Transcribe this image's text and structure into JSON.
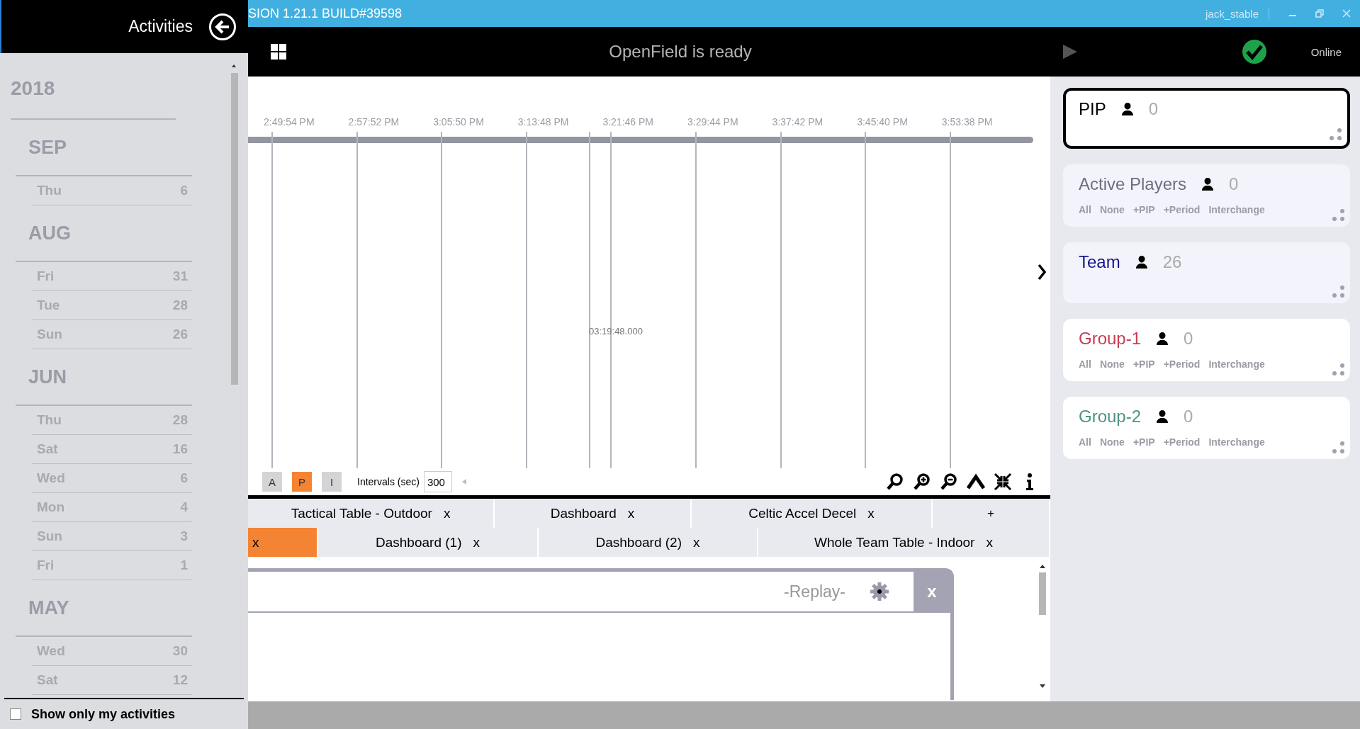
{
  "sidebar": {
    "title": "Activities",
    "years": [
      {
        "year": "2018",
        "months": [
          {
            "month": "SEP",
            "days": [
              {
                "weekday": "Thu",
                "day": "6"
              }
            ]
          },
          {
            "month": "AUG",
            "days": [
              {
                "weekday": "Fri",
                "day": "31"
              },
              {
                "weekday": "Tue",
                "day": "28"
              },
              {
                "weekday": "Sun",
                "day": "26"
              }
            ]
          },
          {
            "month": "JUN",
            "days": [
              {
                "weekday": "Thu",
                "day": "28"
              },
              {
                "weekday": "Sat",
                "day": "16"
              },
              {
                "weekday": "Wed",
                "day": "6"
              },
              {
                "weekday": "Mon",
                "day": "4"
              },
              {
                "weekday": "Sun",
                "day": "3"
              },
              {
                "weekday": "Fri",
                "day": "1"
              }
            ]
          },
          {
            "month": "MAY",
            "days": [
              {
                "weekday": "Wed",
                "day": "30"
              },
              {
                "weekday": "Sat",
                "day": "12"
              }
            ]
          }
        ]
      }
    ],
    "filter": {
      "label": "Show only my activities",
      "checked": false
    }
  },
  "title_bar": {
    "title": "SION 1.21.1 BUILD#39598",
    "user": "jack_stable"
  },
  "status_bar": {
    "message": "OpenField is ready",
    "connection": "Online"
  },
  "timeline": {
    "ticks": [
      "2:49:54 PM",
      "2:57:52 PM",
      "3:05:50 PM",
      "3:13:48 PM",
      "3:21:46 PM",
      "3:29:44 PM",
      "3:37:42 PM",
      "3:45:40 PM",
      "3:53:38 PM"
    ],
    "cursor": "03:19:48.000"
  },
  "toolbar": {
    "modes": [
      {
        "label": "A",
        "selected": false
      },
      {
        "label": "P",
        "selected": true
      },
      {
        "label": "I",
        "selected": false
      }
    ],
    "intervals": {
      "label": "Intervals (sec)",
      "value": "300"
    }
  },
  "tabs": [
    [
      {
        "kind": "tab",
        "label": "Tactical Table - Outdoor",
        "close": "x",
        "selected": false
      },
      {
        "kind": "tab",
        "label": "Dashboard",
        "close": "x",
        "selected": false
      },
      {
        "kind": "tab",
        "label": "Celtic Accel Decel",
        "close": "x",
        "selected": false
      },
      {
        "kind": "add",
        "label": "+",
        "selected": false
      }
    ],
    [
      {
        "kind": "tab",
        "close": "x",
        "selected": true
      },
      {
        "kind": "tab",
        "label": "Dashboard (1)",
        "close": "x",
        "selected": false
      },
      {
        "kind": "tab",
        "label": "Dashboard (2)",
        "close": "x",
        "selected": false
      },
      {
        "kind": "tab",
        "label": "Whole Team Table - Indoor",
        "close": "x",
        "selected": false
      }
    ]
  ],
  "replay": {
    "title": "-Replay-",
    "close": "x"
  },
  "groups": [
    {
      "kind": "pip",
      "name": "PIP",
      "count": "0",
      "color": "#000000",
      "selected": true
    },
    {
      "kind": "builtin",
      "name": "Active Players",
      "count": "0",
      "color": "#6b6f80",
      "selected": false,
      "actions": [
        "All",
        "None",
        "+PIP",
        "+Period",
        "Interchange"
      ]
    },
    {
      "kind": "builtin",
      "name": "Team",
      "count": "26",
      "color": "#14148c",
      "selected": false
    },
    {
      "kind": "group",
      "name": "Group-1",
      "count": "0",
      "color": "#c43d52",
      "selected": false,
      "actions": [
        "All",
        "None",
        "+PIP",
        "+Period",
        "Interchange"
      ]
    },
    {
      "kind": "group",
      "name": "Group-2",
      "count": "0",
      "color": "#4a9483",
      "selected": false,
      "actions": [
        "All",
        "None",
        "+PIP",
        "+Period",
        "Interchange"
      ]
    }
  ]
}
